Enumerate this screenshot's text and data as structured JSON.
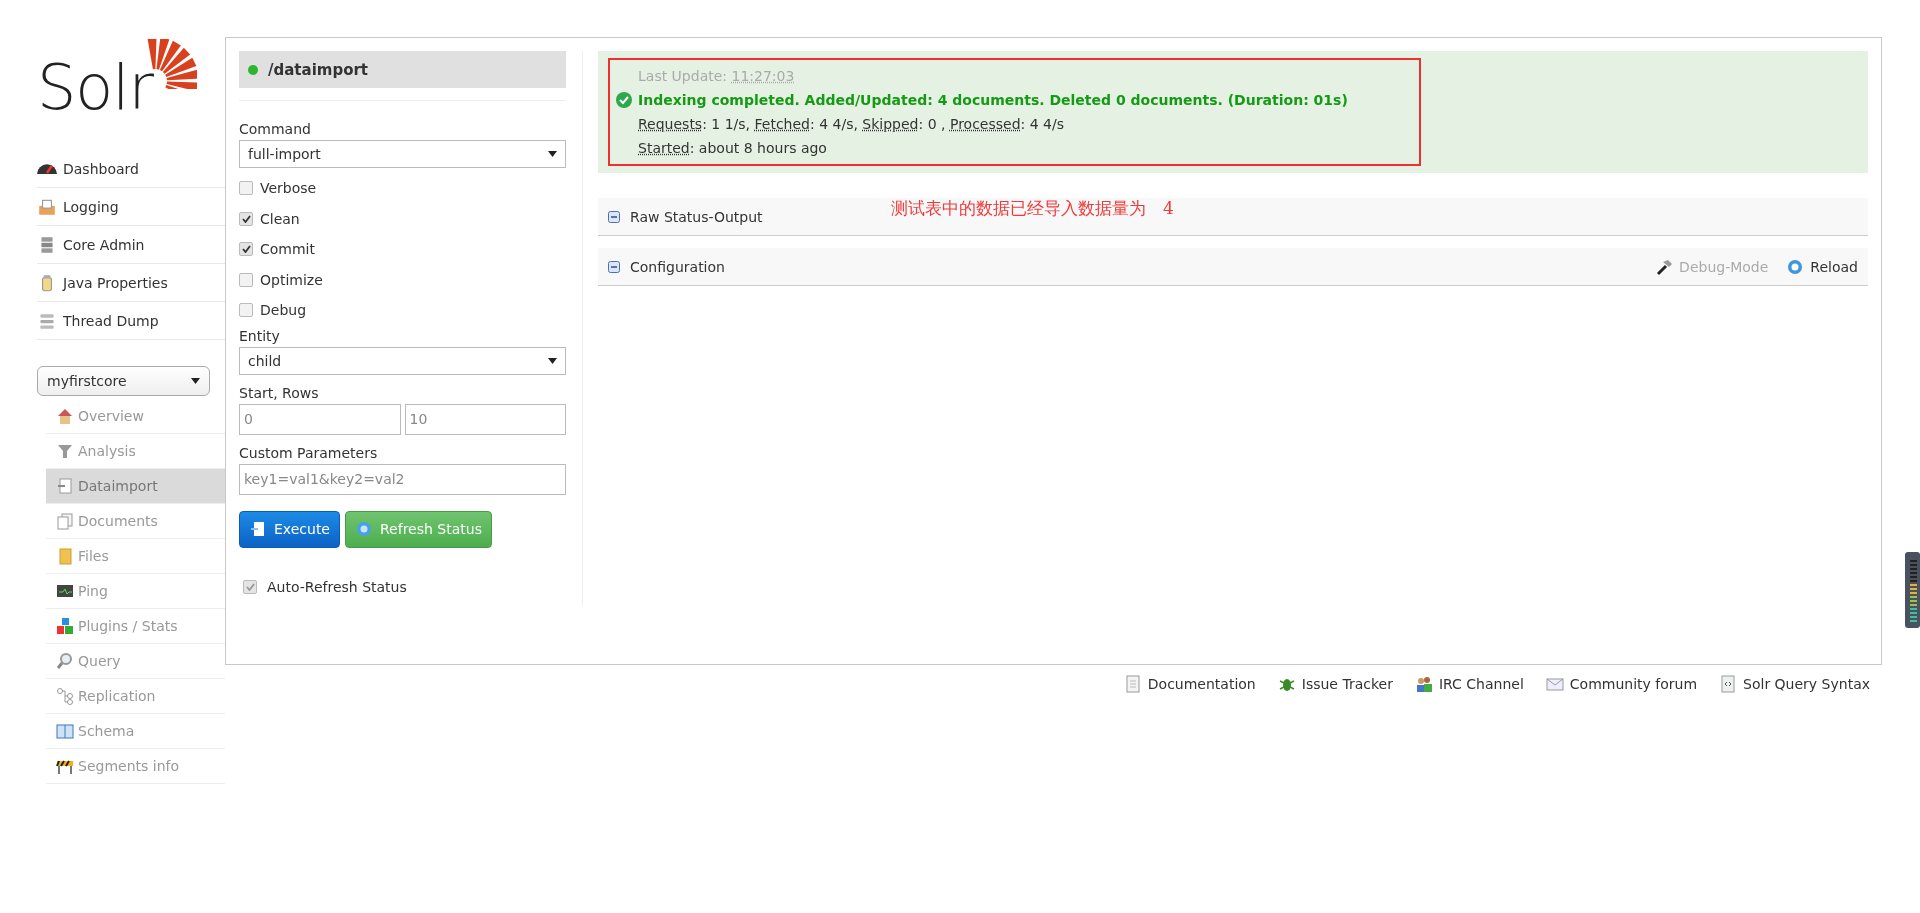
{
  "logo": {
    "text": "Solr"
  },
  "nav": [
    {
      "label": "Dashboard",
      "kind": "dashboard"
    },
    {
      "label": "Logging",
      "kind": "logging"
    },
    {
      "label": "Core Admin",
      "kind": "cores"
    },
    {
      "label": "Java Properties",
      "kind": "java"
    },
    {
      "label": "Thread Dump",
      "kind": "threads"
    }
  ],
  "core_selector": {
    "value": "myfirstcore"
  },
  "core_menu": [
    {
      "label": "Overview",
      "kind": "home",
      "selected": false
    },
    {
      "label": "Analysis",
      "kind": "funnel",
      "selected": false
    },
    {
      "label": "Dataimport",
      "kind": "import",
      "selected": true
    },
    {
      "label": "Documents",
      "kind": "documents",
      "selected": false
    },
    {
      "label": "Files",
      "kind": "folder",
      "selected": false
    },
    {
      "label": "Ping",
      "kind": "monitor",
      "selected": false
    },
    {
      "label": "Plugins / Stats",
      "kind": "blocks",
      "selected": false
    },
    {
      "label": "Query",
      "kind": "search",
      "selected": false
    },
    {
      "label": "Replication",
      "kind": "replication",
      "selected": false
    },
    {
      "label": "Schema",
      "kind": "book",
      "selected": false
    },
    {
      "label": "Segments info",
      "kind": "barrier",
      "selected": false
    }
  ],
  "handler": {
    "title": "/dataimport"
  },
  "form": {
    "command_label": "Command",
    "command": "full-import",
    "options": [
      {
        "label": "Verbose",
        "checked": false
      },
      {
        "label": "Clean",
        "checked": true
      },
      {
        "label": "Commit",
        "checked": true
      },
      {
        "label": "Optimize",
        "checked": false
      },
      {
        "label": "Debug",
        "checked": false
      }
    ],
    "entity_label": "Entity",
    "entity": "child",
    "start_rows_label": "Start, Rows",
    "start": {
      "placeholder": "0"
    },
    "rows": {
      "placeholder": "10"
    },
    "custom_label": "Custom Parameters",
    "custom": {
      "placeholder": "key1=val1&key2=val2"
    },
    "buttons": [
      {
        "label": "Execute",
        "kind": "primary"
      },
      {
        "label": "Refresh Status",
        "kind": "success"
      }
    ],
    "auto_refresh": {
      "label": "Auto-Refresh Status",
      "checked": true
    }
  },
  "status": {
    "last_update_label": "Last Update:",
    "last_update_time": "11:27:03",
    "message": "Indexing completed. Added/Updated: 4 documents. Deleted 0 documents. (Duration: 01s)",
    "stats": [
      {
        "label": "Requests",
        "value": ": 1 1/s, "
      },
      {
        "label": "Fetched",
        "value": ": 4 4/s, "
      },
      {
        "label": "Skipped",
        "value": ": 0 , "
      },
      {
        "label": "Processed",
        "value": ": 4 4/s"
      }
    ],
    "started": [
      {
        "label": "Started",
        "value": ": about 8 hours ago"
      }
    ]
  },
  "annotation": "测试表中的数据已经导入数据量为　4",
  "sections": [
    {
      "label": "Raw Status-Output"
    },
    {
      "label": "Configuration"
    }
  ],
  "config_actions": [
    {
      "label": "Debug-Mode",
      "kind": "debug",
      "disabled": true
    },
    {
      "label": "Reload",
      "kind": "reload",
      "disabled": false
    }
  ],
  "footer": [
    {
      "label": "Documentation",
      "kind": "doc"
    },
    {
      "label": "Issue Tracker",
      "kind": "bug"
    },
    {
      "label": "IRC Channel",
      "kind": "people"
    },
    {
      "label": "Community forum",
      "kind": "mail"
    },
    {
      "label": "Solr Query Syntax",
      "kind": "syntax"
    }
  ]
}
